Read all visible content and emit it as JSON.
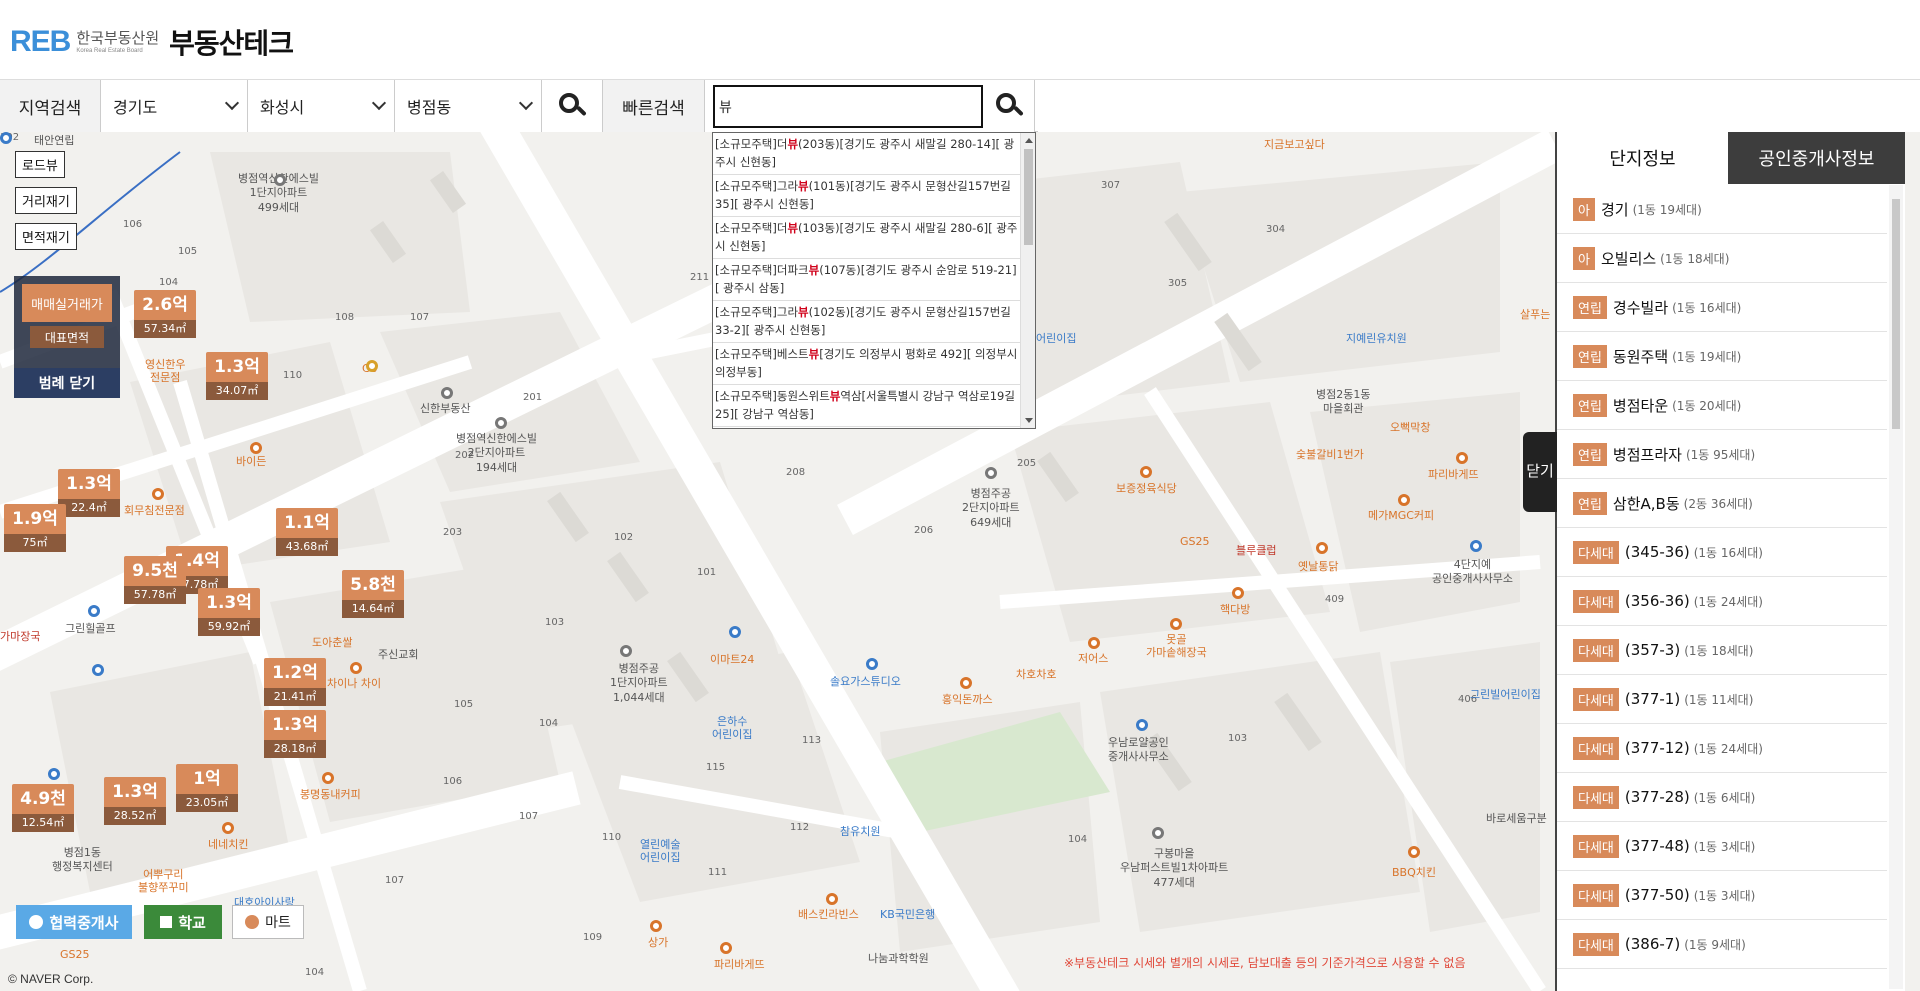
{
  "header": {
    "logo_mark": "REB",
    "logo_korean": "한국부동산원",
    "logo_english": "Korea Real Estate Board",
    "title": "부동산테크"
  },
  "search": {
    "region_label": "지역검색",
    "province": "경기도",
    "city": "화성시",
    "dong": "병점동",
    "quick_label": "빠른검색",
    "quick_value": "뷰"
  },
  "autocomplete": [
    {
      "pre": "[소규모주택]더",
      "hl": "뷰",
      "post": "(203동)[경기도 광주시 새말길 280-14][ 광주시 신현동]"
    },
    {
      "pre": "[소규모주택]그라",
      "hl": "뷰",
      "post": "(101동)[경기도 광주시 문형산길157번길 35][ 광주시 신현동]"
    },
    {
      "pre": "[소규모주택]더",
      "hl": "뷰",
      "post": "(103동)[경기도 광주시 새말길 280-6][ 광주시 신현동]"
    },
    {
      "pre": "[소규모주택]더파크",
      "hl": "뷰",
      "post": "(107동)[경기도 광주시 순암로 519-21][ 광주시 삼동]"
    },
    {
      "pre": "[소규모주택]그라",
      "hl": "뷰",
      "post": "(102동)[경기도 광주시 문형산길157번길 33-2][ 광주시 신현동]"
    },
    {
      "pre": "[소규모주택]베스트",
      "hl": "뷰",
      "post": "[경기도 의정부시 평화로 492][ 의정부시 의정부동]"
    },
    {
      "pre": "[소규모주택]동원스위트",
      "hl": "뷰",
      "post": "역삼[서울특별시 강남구 역삼로19길 25][ 강남구 역삼동]"
    }
  ],
  "map_tools": {
    "roadview": "로드뷰",
    "distance": "거리재기",
    "area": "면적재기"
  },
  "legend": {
    "price": "매매실거래가",
    "area": "대표면적",
    "close": "범례 닫기"
  },
  "price_markers": [
    {
      "price": "2.6억",
      "area": "57.34㎡"
    },
    {
      "price": "1.3억",
      "area": "34.07㎡"
    },
    {
      "price": "1.3억",
      "area": "22.4㎡"
    },
    {
      "price": "1.9억",
      "area": "75㎡"
    },
    {
      "price": "1.1억",
      "area": "43.68㎡"
    },
    {
      "price": "1.4억",
      "area": "17.78㎡"
    },
    {
      "price": "9.5천",
      "area": "57.78㎡"
    },
    {
      "price": "1.3억",
      "area": "59.92㎡"
    },
    {
      "price": "5.8천",
      "area": "14.64㎡"
    },
    {
      "price": "1.2억",
      "area": "21.41㎡"
    },
    {
      "price": "1.3억",
      "area": "28.18㎡"
    },
    {
      "price": "4.9천",
      "area": "12.54㎡"
    },
    {
      "price": "1.3억",
      "area": "28.52㎡"
    },
    {
      "price": "1억",
      "area": "23.05㎡"
    }
  ],
  "map_labels": {
    "apt1": "병점역신한에스빌\n1단지아파트\n499세대",
    "apt2": "병점역신한에스빌\n2단지아파트\n194세대",
    "apt3": "병점주공\n2단지아파트\n649세대",
    "apt4": "병점주공\n1단지아파트\n1,044세대",
    "apt5": "구봉마을\n우남퍼스트빌1차아파트\n477세대",
    "taean": "태안연립",
    "cu": "CU",
    "shinhan_realty": "신한부동산",
    "baiden": "바이든",
    "yeongsin": "영신한우\n전문점",
    "hoemu": "회무침전문점",
    "grinhill": "그린힐골프",
    "jusin": "주신교회",
    "doamaebal": "도아춘쌀",
    "china": "차이나 차이",
    "emart": "이마트24",
    "solyo": "솔요가스튜디오",
    "eunhasu": "은하수\n어린이집",
    "hongik": "홍익돈까스",
    "chahochaho": "차호차호",
    "jeoeseu": "저어스",
    "motgol": "못골\n가마솥해장국",
    "woonam": "우남로얄공인\n중개사사무소",
    "bosung": "보증정육식당",
    "gs25": "GS25",
    "blueclub": "블루클럽",
    "yetnal": "옛날통닭",
    "haekdabang": "핵다방",
    "jiyerin": "지예린유치원",
    "byeongjeom2": "병점2동1동\n마을회관",
    "odeok": "오뻑막창",
    "sutbul": "숯불갈비1번가",
    "paris1": "파리바게뜨",
    "mega": "메가MGC커피",
    "sadan": "4단지예\n공인중개사사무소",
    "green": "그린빌어린이집",
    "baroeum": "바로세움구분",
    "bbq": "BBQ치킨",
    "jigeum": "지금보고싶다",
    "salpu": "살푸는",
    "jamsil": "참유치원",
    "yeolrin": "열린예술\n어린이집",
    "baskin": "배스킨라빈스",
    "kb": "KB국민은행",
    "nanum": "나눔과학학원",
    "sangga": "상가",
    "paris2": "파리바게뜨",
    "bongmyeong": "봉명동내커피",
    "eomukguri": "어뿌구리\n불향쭈꾸미",
    "nene": "네네치킨",
    "byeongjeom1": "병점1동\n행정복지센터",
    "daeho": "대호아이사랑",
    "gs25b": "GS25",
    "gamajang": "가마장국",
    "ijip": "어린이집"
  },
  "panel": {
    "tab_active": "단지정보",
    "tab_inactive": "공인중개사정보",
    "close_label": "닫기",
    "items": [
      {
        "type": "아",
        "name": "경기",
        "count": "(1동 19세대)"
      },
      {
        "type": "아",
        "name": "오빌리스",
        "count": "(1동 18세대)"
      },
      {
        "type": "연립",
        "name": "경수빌라",
        "count": "(1동 16세대)"
      },
      {
        "type": "연립",
        "name": "동원주택",
        "count": "(1동 19세대)"
      },
      {
        "type": "연립",
        "name": "병점타운",
        "count": "(1동 20세대)"
      },
      {
        "type": "연립",
        "name": "병점프라자",
        "count": "(1동 95세대)"
      },
      {
        "type": "연립",
        "name": "삼한A,B동",
        "count": "(2동 36세대)"
      },
      {
        "type": "다세대",
        "name": "(345-36)",
        "count": "(1동 16세대)"
      },
      {
        "type": "다세대",
        "name": "(356-36)",
        "count": "(1동 24세대)"
      },
      {
        "type": "다세대",
        "name": "(357-3)",
        "count": "(1동 18세대)"
      },
      {
        "type": "다세대",
        "name": "(377-1)",
        "count": "(1동 11세대)"
      },
      {
        "type": "다세대",
        "name": "(377-12)",
        "count": "(1동 24세대)"
      },
      {
        "type": "다세대",
        "name": "(377-28)",
        "count": "(1동 6세대)"
      },
      {
        "type": "다세대",
        "name": "(377-48)",
        "count": "(1동 3세대)"
      },
      {
        "type": "다세대",
        "name": "(377-50)",
        "count": "(1동 3세대)"
      },
      {
        "type": "다세대",
        "name": "(386-7)",
        "count": "(1동 9세대)"
      }
    ]
  },
  "bottom_buttons": {
    "agent": "협력중개사",
    "school": "학교",
    "mart": "마트"
  },
  "disclaimer": "※부동산테크 시세와 별개의 시세로, 담보대출 등의 기준가격으로 사용할 수 없음",
  "naver": "© NAVER Corp.",
  "colors": {
    "price_marker": "#d88a5a",
    "area_marker": "#8b5a3c",
    "legend_close": "#2c3e63",
    "highlight": "#d0021b"
  }
}
